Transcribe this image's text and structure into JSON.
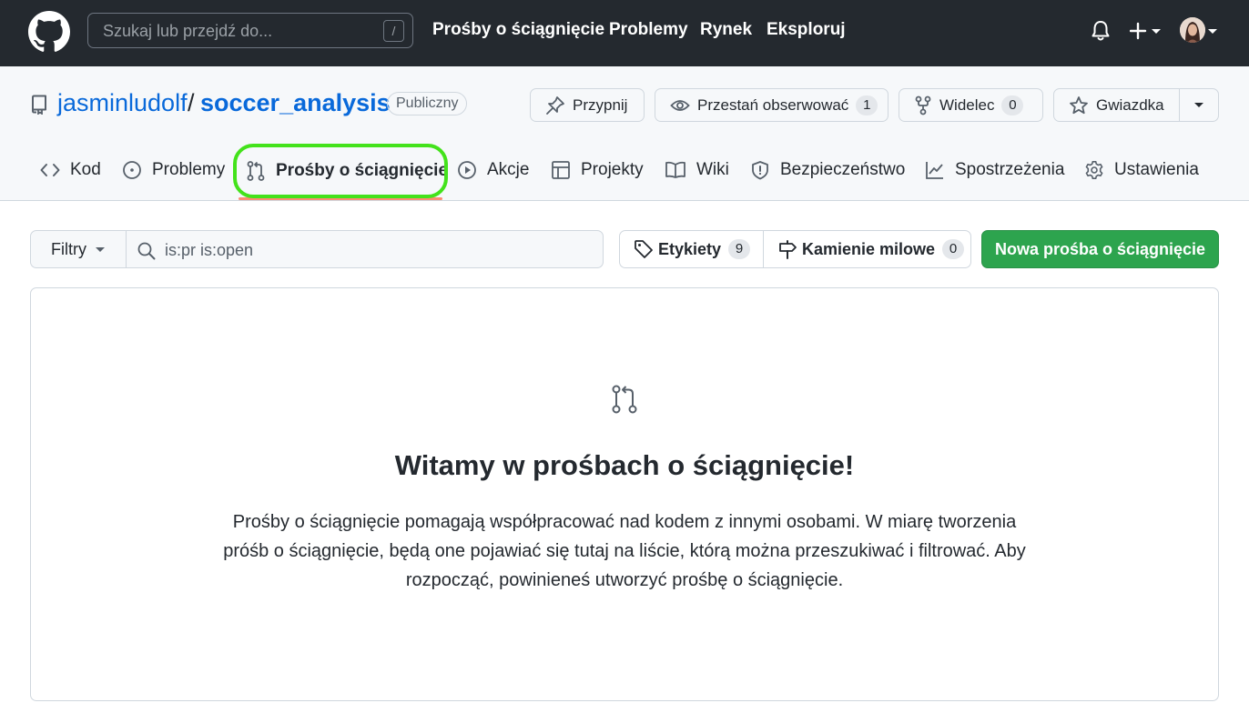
{
  "header": {
    "search_placeholder": "Szukaj lub przejdź do...",
    "search_shortcut": "/",
    "nav": [
      "Prośby o ściągnięcie",
      "Problemy",
      "Rynek",
      "Eksploruj"
    ]
  },
  "repo": {
    "owner": "jasminludolf",
    "separator": "/",
    "name": "soccer_analysis",
    "visibility": "Publiczny",
    "actions": {
      "pin_label": "Przypnij",
      "unwatch_label": "Przestań obserwować",
      "watch_count": "1",
      "fork_label": "Widelec",
      "fork_count": "0",
      "star_label": "Gwiazdka"
    }
  },
  "tabs": [
    {
      "label": "Kod",
      "icon": "code-icon"
    },
    {
      "label": "Problemy",
      "icon": "issue-opened-icon"
    },
    {
      "label": "Prośby o ściągnięcie",
      "icon": "git-pull-request-icon",
      "selected": true
    },
    {
      "label": "Akcje",
      "icon": "play-icon"
    },
    {
      "label": "Projekty",
      "icon": "table-icon"
    },
    {
      "label": "Wiki",
      "icon": "book-icon"
    },
    {
      "label": "Bezpieczeństwo",
      "icon": "shield-icon"
    },
    {
      "label": "Spostrzeżenia",
      "icon": "graph-icon"
    },
    {
      "label": "Ustawienia",
      "icon": "gear-icon"
    }
  ],
  "toolbar": {
    "filters_label": "Filtry",
    "filter_query": "is:pr is:open",
    "labels_label": "Etykiety",
    "labels_count": "9",
    "milestones_label": "Kamienie milowe",
    "milestones_count": "0",
    "new_pr_label": "Nowa prośba o ściągnięcie"
  },
  "blankslate": {
    "title": "Witamy w prośbach o ściągnięcie!",
    "line1": "Prośby o ściągnięcie pomagają współpracować nad kodem z innymi osobami. W miarę tworzenia",
    "line2": "próśb o ściągnięcie, będą one pojawiać się tutaj na liście, którą można przeszukiwać i filtrować. Aby",
    "line3": "rozpocząć, powinieneś utworzyć prośbę o ściągnięcie."
  },
  "colors": {
    "header_bg": "#24292f",
    "link": "#0969da",
    "primary_button": "#2da44e",
    "tab_highlight": "#43e21b",
    "selected_underline": "#fd8c73"
  }
}
